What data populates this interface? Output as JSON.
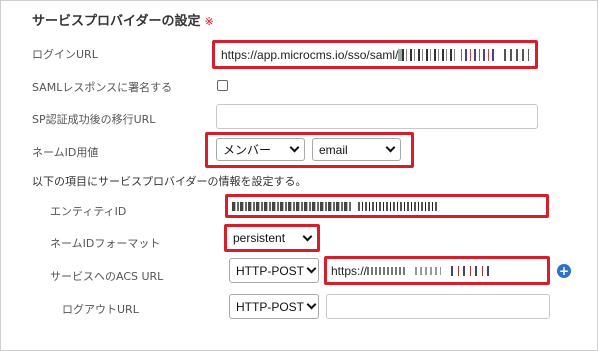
{
  "section": {
    "title": "サービスプロバイダーの設定",
    "required_mark": "※"
  },
  "login_url": {
    "label": "ログインURL",
    "value": "https://app.microcms.io/sso/saml/"
  },
  "saml_sign": {
    "label": "SAMLレスポンスに署名する",
    "checked": false
  },
  "sp_redirect": {
    "label": "SP認証成功後の移行URL",
    "value": ""
  },
  "name_id_value": {
    "label": "ネームID用値",
    "select1": "メンバー",
    "select2": "email"
  },
  "sp_info_heading": "以下の項目にサービスプロバイダーの情報を設定する。",
  "entity_id": {
    "label": "エンティティID"
  },
  "name_id_format": {
    "label": "ネームIDフォーマット",
    "value": "persistent"
  },
  "acs_url": {
    "label": "サービスへのACS URL",
    "method": "HTTP-POST",
    "value": "https://"
  },
  "logout_url": {
    "label": "ログアウトURL",
    "method": "HTTP-POST",
    "value": ""
  },
  "colors": {
    "highlight": "#d4202a",
    "required": "#e60012",
    "add_button": "#2f73c9"
  },
  "icons": {
    "select_arrow": "chevron-down-icon",
    "add": "plus-circle-icon"
  }
}
